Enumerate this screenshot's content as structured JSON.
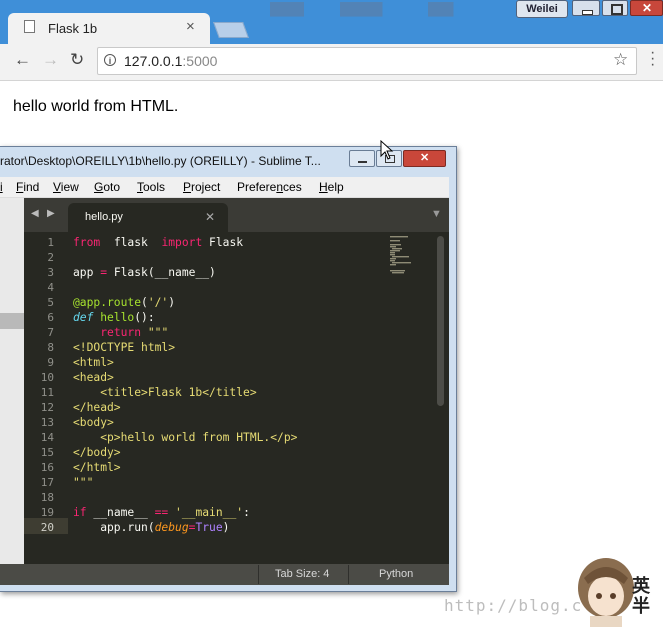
{
  "browser": {
    "tab_title": "Flask 1b",
    "tab_close": "×",
    "user_name": "Weilei",
    "url_host": "127.0.0.1",
    "url_port": ":5000",
    "icons": [
      "back-arrow-icon",
      "forward-arrow-icon",
      "reload-icon",
      "info-icon",
      "star-icon",
      "menu-icon",
      "document-icon"
    ]
  },
  "page": {
    "text": "hello world from HTML."
  },
  "sublime": {
    "window_title": "rator\\Desktop\\OREILLY\\1b\\hello.py (OREILLY) - Sublime T...",
    "menu": [
      {
        "pre": "",
        "u": "F",
        "post": "ind"
      },
      {
        "pre": "",
        "u": "V",
        "post": "iew"
      },
      {
        "pre": "",
        "u": "G",
        "post": "oto"
      },
      {
        "pre": "",
        "u": "T",
        "post": "ools"
      },
      {
        "pre": "",
        "u": "P",
        "post": "roject"
      },
      {
        "pre": "Prefere",
        "u": "n",
        "post": "ces"
      },
      {
        "pre": "",
        "u": "H",
        "post": "elp"
      }
    ],
    "file_tab": "hello.py",
    "lines": [
      [
        [
          "k",
          "from"
        ],
        [
          "",
          "  flask  "
        ],
        [
          "k",
          "import"
        ],
        [
          "",
          " Flask"
        ]
      ],
      [],
      [
        [
          "",
          "app "
        ],
        [
          "k",
          "="
        ],
        [
          "",
          " Flask(__name__)"
        ]
      ],
      [],
      [
        [
          "f",
          "@app.route"
        ],
        [
          "",
          "("
        ],
        [
          "s",
          "'/'"
        ],
        [
          "",
          ")"
        ]
      ],
      [
        [
          "i",
          "def"
        ],
        [
          "",
          ""
        ],
        [
          "f",
          " hello"
        ],
        [
          "",
          "():"
        ]
      ],
      [
        [
          "",
          "    "
        ],
        [
          "k",
          "return"
        ],
        [
          "",
          " "
        ],
        [
          "s",
          "\"\"\""
        ]
      ],
      [
        [
          "s",
          "<!DOCTYPE html>"
        ]
      ],
      [
        [
          "s",
          "<html>"
        ]
      ],
      [
        [
          "s",
          "<head>"
        ]
      ],
      [
        [
          "s",
          "    <title>Flask 1b</title>"
        ]
      ],
      [
        [
          "s",
          "</head>"
        ]
      ],
      [
        [
          "s",
          "<body>"
        ]
      ],
      [
        [
          "s",
          "    <p>hello world from HTML.</p>"
        ]
      ],
      [
        [
          "s",
          "</body>"
        ]
      ],
      [
        [
          "s",
          "</html>"
        ]
      ],
      [
        [
          "s",
          "\"\"\""
        ]
      ],
      [],
      [
        [
          "k",
          "if"
        ],
        [
          "",
          " __name__ "
        ],
        [
          "k",
          "=="
        ],
        [
          "",
          " "
        ],
        [
          "s",
          "'__main__'"
        ],
        [
          "",
          ":"
        ]
      ],
      [
        [
          "",
          "    app.run("
        ],
        [
          "o",
          "debug"
        ],
        [
          "k",
          "="
        ],
        [
          "p",
          "True"
        ],
        [
          "",
          ")"
        ]
      ]
    ],
    "status": {
      "tab_size": "Tab Size: 4",
      "syntax": "Python"
    }
  },
  "watermark": {
    "url": "http://blog.c",
    "seal": [
      "英",
      "半"
    ]
  },
  "colors": {
    "editor_bg": "#272822",
    "keyword": "#f92672",
    "string": "#e6db74",
    "function": "#a6e22e",
    "chrome_blue": "#3f8fd8"
  }
}
